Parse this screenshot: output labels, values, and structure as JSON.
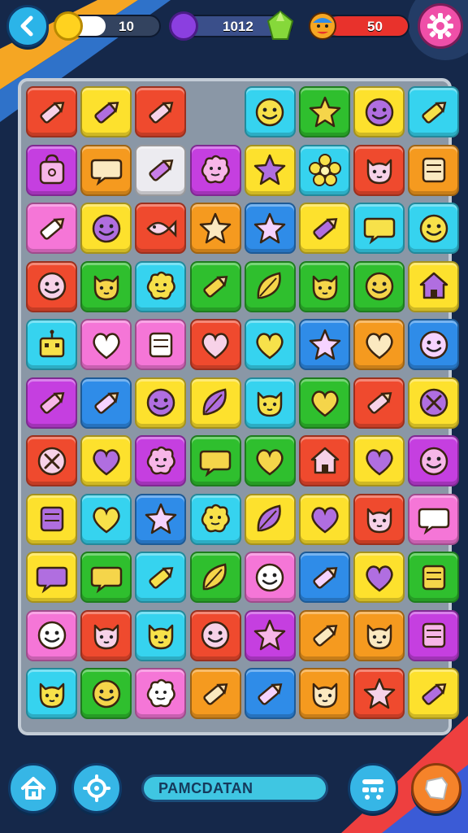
{
  "hud": {
    "coins_value": "10",
    "coins_progress": 0.45,
    "gems_value": "1012",
    "lives_value": "50"
  },
  "icons": {
    "back": "back-arrow-icon",
    "settings": "gear-icon",
    "home": "home-icon",
    "settings_bottom": "gear-icon",
    "menu": "grid-menu-icon",
    "extra": "shield-icon"
  },
  "bottom": {
    "label": "PAMCDATAN"
  },
  "colors": {
    "red": "#ef4a2e",
    "yellow": "#fde12d",
    "cyan": "#36d3ef",
    "green": "#2fbf2e",
    "magenta": "#c53fe0",
    "orange": "#f59a1f",
    "pink": "#f576d7",
    "blue": "#2f8ce8",
    "white": "#ecebf0",
    "purple": "#9b46e6",
    "lime": "#3bd957"
  },
  "board": {
    "rows": [
      [
        [
          "red",
          "pencil"
        ],
        [
          "yellow",
          "pencil"
        ],
        [
          "red",
          "pencil"
        ],
        [
          "cyan",
          "face"
        ],
        [
          "green",
          "star"
        ],
        [
          "yellow",
          "face"
        ],
        [
          "cyan",
          "pencil"
        ]
      ],
      [
        [
          "magenta",
          "bag"
        ],
        [
          "orange",
          "bubble"
        ],
        [
          "white",
          "pencil"
        ],
        [
          "magenta",
          "blob"
        ],
        [
          "yellow",
          "star"
        ],
        [
          "cyan",
          "flower"
        ],
        [
          "red",
          "cat"
        ],
        [
          "orange",
          "box"
        ]
      ],
      [
        [
          "pink",
          "pencil"
        ],
        [
          "yellow",
          "face"
        ],
        [
          "red",
          "fish"
        ],
        [
          "orange",
          "star"
        ],
        [
          "blue",
          "star"
        ],
        [
          "yellow",
          "pencil"
        ],
        [
          "cyan",
          "bubble"
        ],
        [
          "cyan",
          "face"
        ]
      ],
      [
        [
          "red",
          "face"
        ],
        [
          "green",
          "cat"
        ],
        [
          "cyan",
          "blob"
        ],
        [
          "green",
          "pencil"
        ],
        [
          "green",
          "leaf"
        ],
        [
          "green",
          "cat"
        ],
        [
          "green",
          "face"
        ],
        [
          "yellow",
          "house"
        ]
      ],
      [
        [
          "cyan",
          "robot"
        ],
        [
          "pink",
          "heart"
        ],
        [
          "pink",
          "box"
        ],
        [
          "red",
          "heart"
        ],
        [
          "cyan",
          "heart"
        ],
        [
          "blue",
          "star"
        ],
        [
          "orange",
          "heart"
        ],
        [
          "blue",
          "face"
        ]
      ],
      [
        [
          "magenta",
          "pencil"
        ],
        [
          "blue",
          "pencil"
        ],
        [
          "yellow",
          "face"
        ],
        [
          "yellow",
          "leaf"
        ],
        [
          "cyan",
          "cat"
        ],
        [
          "green",
          "heart"
        ],
        [
          "red",
          "pencil"
        ],
        [
          "yellow",
          "cross"
        ]
      ],
      [
        [
          "red",
          "cross"
        ],
        [
          "yellow",
          "heart"
        ],
        [
          "magenta",
          "blob"
        ],
        [
          "green",
          "bubble"
        ],
        [
          "green",
          "heart"
        ],
        [
          "red",
          "house"
        ],
        [
          "yellow",
          "heart"
        ],
        [
          "magenta",
          "face"
        ]
      ],
      [
        [
          "yellow",
          "box"
        ],
        [
          "cyan",
          "heart"
        ],
        [
          "blue",
          "star"
        ],
        [
          "cyan",
          "blob"
        ],
        [
          "yellow",
          "leaf"
        ],
        [
          "yellow",
          "heart"
        ],
        [
          "red",
          "cat"
        ],
        [
          "pink",
          "bubble"
        ]
      ],
      [
        [
          "yellow",
          "bubble"
        ],
        [
          "green",
          "bubble"
        ],
        [
          "cyan",
          "pencil"
        ],
        [
          "green",
          "leaf"
        ],
        [
          "pink",
          "face"
        ],
        [
          "blue",
          "pencil"
        ],
        [
          "yellow",
          "heart"
        ],
        [
          "green",
          "box"
        ]
      ],
      [
        [
          "pink",
          "face"
        ],
        [
          "red",
          "cat"
        ],
        [
          "cyan",
          "cat"
        ],
        [
          "red",
          "face"
        ],
        [
          "magenta",
          "star"
        ],
        [
          "orange",
          "pencil"
        ],
        [
          "orange",
          "cat"
        ],
        [
          "magenta",
          "box"
        ]
      ],
      [
        [
          "cyan",
          "cat"
        ],
        [
          "green",
          "face"
        ],
        [
          "pink",
          "blob"
        ],
        [
          "orange",
          "pencil"
        ],
        [
          "blue",
          "pencil"
        ],
        [
          "orange",
          "cat"
        ],
        [
          "red",
          "star"
        ],
        [
          "yellow",
          "pencil"
        ]
      ]
    ]
  }
}
